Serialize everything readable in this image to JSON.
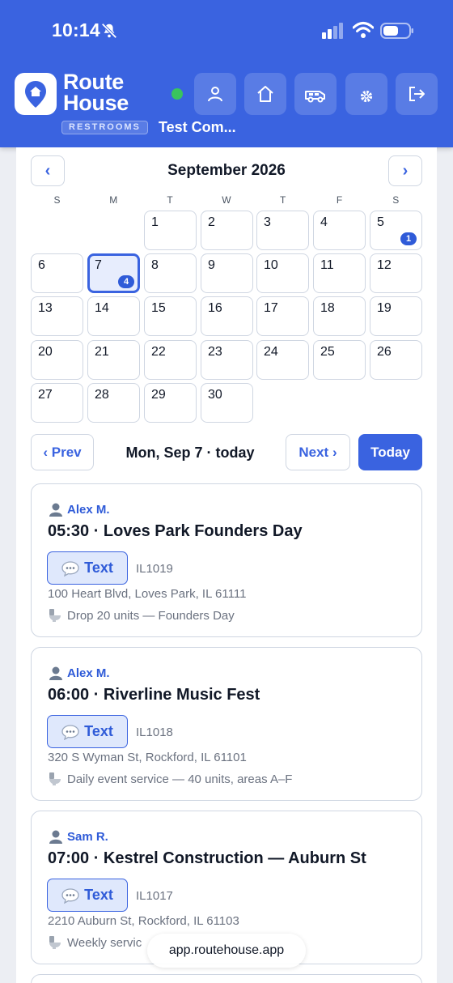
{
  "status_bar": {
    "time": "10:14",
    "icons": [
      "bell-slash-icon",
      "cellular-signal-icon",
      "wifi-icon",
      "battery-icon"
    ]
  },
  "header": {
    "brand": "Route House",
    "subtitle": "RESTROOMS",
    "company": "Test Com...",
    "online_color": "#39c45e",
    "accent_color": "#3a63e0",
    "buttons": [
      "user-icon",
      "home-icon",
      "truck-icon",
      "gear-icon",
      "logout-icon"
    ]
  },
  "calendar": {
    "month_label": "September 2026",
    "prev_icon": "‹",
    "next_icon": "›",
    "weekdays": [
      "S",
      "M",
      "T",
      "W",
      "T",
      "F",
      "S"
    ],
    "selected_day": 7,
    "days": [
      {
        "label": "1",
        "badge": ""
      },
      {
        "label": "2",
        "badge": ""
      },
      {
        "label": "3",
        "badge": ""
      },
      {
        "label": "4",
        "badge": ""
      },
      {
        "label": "5",
        "badge": "1"
      },
      {
        "label": "6",
        "badge": ""
      },
      {
        "label": "7",
        "badge": "4"
      },
      {
        "label": "8",
        "badge": ""
      },
      {
        "label": "9",
        "badge": ""
      },
      {
        "label": "10",
        "badge": ""
      },
      {
        "label": "11",
        "badge": ""
      },
      {
        "label": "12",
        "badge": ""
      },
      {
        "label": "13",
        "badge": ""
      },
      {
        "label": "14",
        "badge": ""
      },
      {
        "label": "15",
        "badge": ""
      },
      {
        "label": "16",
        "badge": ""
      },
      {
        "label": "17",
        "badge": ""
      },
      {
        "label": "18",
        "badge": ""
      },
      {
        "label": "19",
        "badge": ""
      },
      {
        "label": "20",
        "badge": ""
      },
      {
        "label": "21",
        "badge": ""
      },
      {
        "label": "22",
        "badge": ""
      },
      {
        "label": "23",
        "badge": ""
      },
      {
        "label": "24",
        "badge": ""
      },
      {
        "label": "25",
        "badge": ""
      },
      {
        "label": "26",
        "badge": ""
      },
      {
        "label": "27",
        "badge": ""
      },
      {
        "label": "28",
        "badge": ""
      },
      {
        "label": "29",
        "badge": ""
      },
      {
        "label": "30",
        "badge": ""
      }
    ]
  },
  "day_nav": {
    "prev_label": "‹ Prev",
    "current_label": "Mon, Sep 7 · today",
    "next_label": "Next ›",
    "today_label": "Today"
  },
  "jobs": [
    {
      "driver": "Alex M.",
      "title": "05:30 · Loves Park Founders Day",
      "text_button": "Text",
      "id": "IL1019",
      "address": "100 Heart Blvd, Loves Park, IL 61111",
      "note": "Drop 20 units — Founders Day"
    },
    {
      "driver": "Alex M.",
      "title": "06:00 · Riverline Music Fest",
      "text_button": "Text",
      "id": "IL1018",
      "address": "320 S Wyman St, Rockford, IL 61101",
      "note": "Daily event service — 40 units, areas A–F"
    },
    {
      "driver": "Sam R.",
      "title": "07:00 · Kestrel Construction — Auburn St",
      "text_button": "Text",
      "id": "IL1017",
      "address": "2210 Auburn St, Rockford, IL 61103",
      "note": "Weekly servic"
    }
  ],
  "browser": {
    "url": "app.routehouse.app"
  }
}
